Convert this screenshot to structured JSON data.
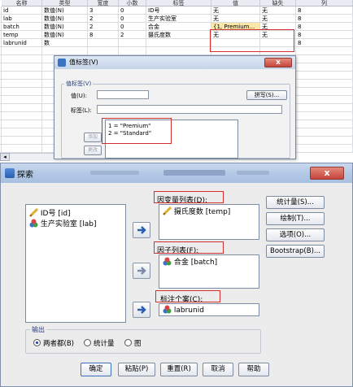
{
  "var_view": {
    "headers": [
      "名称",
      "类型",
      "宽度",
      "小数",
      "标签",
      "值",
      "缺失",
      "列"
    ],
    "rows": [
      [
        "id",
        "数值(N)",
        "3",
        "0",
        "ID号",
        "无",
        "无",
        "8"
      ],
      [
        "lab",
        "数值(N)",
        "2",
        "0",
        "生产实验室",
        "无",
        "无",
        "8"
      ],
      [
        "batch",
        "数值(N)",
        "2",
        "0",
        "合金",
        "{1, Premium...",
        "无",
        "8"
      ],
      [
        "temp",
        "数值(N)",
        "8",
        "2",
        "摄氏度数",
        "无",
        "无",
        "8"
      ],
      [
        "labrunid",
        "数",
        "",
        "",
        "",
        "",
        "",
        "8"
      ]
    ]
  },
  "value_labels_dialog": {
    "title": "值标签(V)",
    "group_label": "值标签(V)",
    "value_label": "值(U):",
    "label_label": "标签(L):",
    "spell_button": "拼写(S)...",
    "add_button": "添加(A)",
    "change_button": "更改(C)",
    "list": [
      "1 = \"Premium\"",
      "2 = \"Standard\""
    ],
    "close": "x"
  },
  "explore_dialog": {
    "title": "探索",
    "close": "x",
    "source_vars": [
      {
        "label": "ID号 [id]",
        "icon": "ruler-icon"
      },
      {
        "label": "生产实验室 [lab]",
        "icon": "nominal-icon"
      }
    ],
    "dependent_label": "因变量列表(D):",
    "dependent_items": [
      "摄氏度数 [temp]"
    ],
    "factor_label": "因子列表(F):",
    "factor_items": [
      "合金 [batch]"
    ],
    "case_label_title": "标注个案(C):",
    "case_label_item": "labrunid",
    "side_buttons": [
      "统计量(S)...",
      "绘制(T)...",
      "选项(O)...",
      "Bootstrap(B)..."
    ],
    "output_title": "输出",
    "output_options": [
      "两者都(B)",
      "统计量",
      "图"
    ],
    "output_selected": "两者都(B)",
    "bottom_buttons": [
      "确定",
      "粘贴(P)",
      "重置(R)",
      "取消",
      "帮助"
    ]
  }
}
